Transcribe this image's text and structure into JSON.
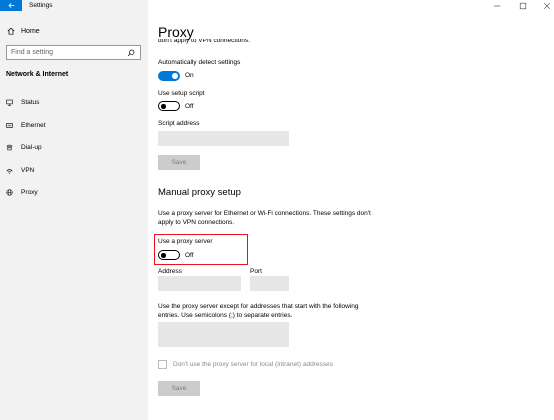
{
  "window": {
    "title": "Settings",
    "controls": [
      "minimize-icon",
      "maximize-icon",
      "close-icon"
    ]
  },
  "sidebar": {
    "home_label": "Home",
    "search_placeholder": "Find a setting",
    "section_header": "Network & Internet",
    "items": [
      {
        "label": "Status",
        "icon": "status-icon"
      },
      {
        "label": "Ethernet",
        "icon": "ethernet-icon"
      },
      {
        "label": "Dial-up",
        "icon": "dialup-icon"
      },
      {
        "label": "VPN",
        "icon": "vpn-icon"
      },
      {
        "label": "Proxy",
        "icon": "proxy-icon"
      }
    ]
  },
  "main": {
    "title": "Proxy",
    "cut_text": "don't apply to VPN connections.",
    "auto": {
      "detect_label": "Automatically detect settings",
      "detect_state": "On",
      "script_label": "Use setup script",
      "script_state": "Off",
      "script_address_label": "Script address",
      "save_label": "Save"
    },
    "manual": {
      "heading": "Manual proxy setup",
      "description": "Use a proxy server for Ethernet or Wi-Fi connections. These settings don't apply to VPN connections.",
      "use_proxy_label": "Use a proxy server",
      "use_proxy_state": "Off",
      "address_label": "Address",
      "port_label": "Port",
      "exceptions_description": "Use the proxy server except for addresses that start with the following entries. Use semicolons (;) to separate entries.",
      "local_bypass_label": "Don't use the proxy server for local (intranet) addresses",
      "save_label": "Save"
    }
  },
  "colors": {
    "accent": "#0078d7",
    "highlight_border": "#e81123",
    "sidebar_bg": "#f2f2f2"
  }
}
